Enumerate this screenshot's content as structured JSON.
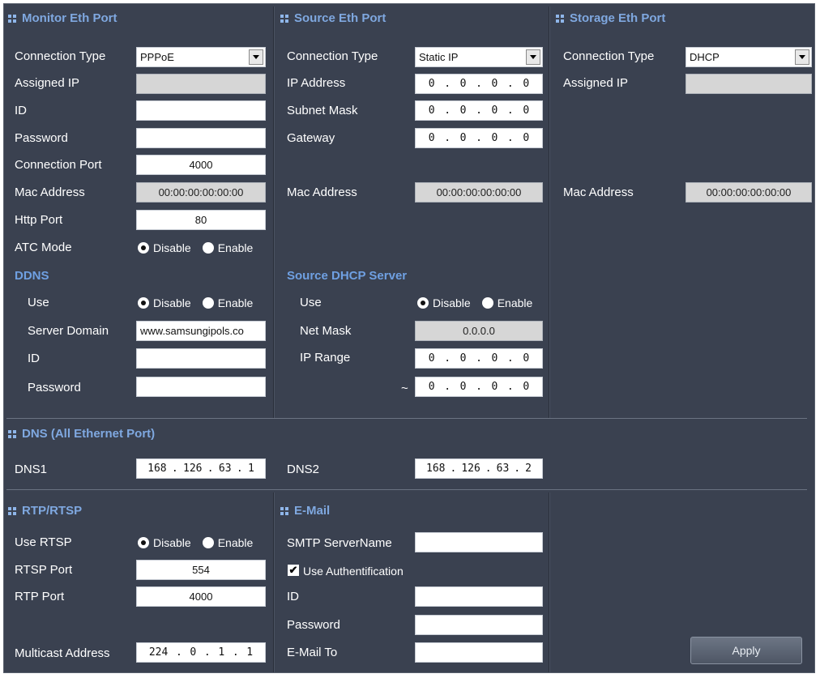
{
  "monitor": {
    "title": "Monitor Eth Port",
    "connection_type_label": "Connection Type",
    "connection_type_value": "PPPoE",
    "assigned_ip_label": "Assigned IP",
    "id_label": "ID",
    "password_label": "Password",
    "connection_port_label": "Connection Port",
    "connection_port_value": "4000",
    "mac_label": "Mac Address",
    "mac_value": "00:00:00:00:00:00",
    "http_port_label": "Http Port",
    "http_port_value": "80",
    "atc_mode_label": "ATC Mode",
    "atc_disable": "Disable",
    "atc_enable": "Enable"
  },
  "ddns": {
    "title": "DDNS",
    "use_label": "Use",
    "use_disable": "Disable",
    "use_enable": "Enable",
    "server_domain_label": "Server Domain",
    "server_domain_value": "www.samsungipols.co",
    "id_label": "ID",
    "password_label": "Password"
  },
  "source": {
    "title": "Source Eth Port",
    "connection_type_label": "Connection Type",
    "connection_type_value": "Static IP",
    "ip_label": "IP Address",
    "subnet_label": "Subnet Mask",
    "gateway_label": "Gateway",
    "ip_value": [
      "0",
      "0",
      "0",
      "0"
    ],
    "subnet_value": [
      "0",
      "0",
      "0",
      "0"
    ],
    "gateway_value": [
      "0",
      "0",
      "0",
      "0"
    ],
    "mac_label": "Mac Address",
    "mac_value": "00:00:00:00:00:00"
  },
  "dhcp": {
    "title": "Source DHCP Server",
    "use_label": "Use",
    "use_disable": "Disable",
    "use_enable": "Enable",
    "netmask_label": "Net Mask",
    "netmask_value": "0.0.0.0",
    "range_label": "IP Range",
    "range_sep": "~",
    "range_start": [
      "0",
      "0",
      "0",
      "0"
    ],
    "range_end": [
      "0",
      "0",
      "0",
      "0"
    ]
  },
  "storage": {
    "title": "Storage Eth Port",
    "connection_type_label": "Connection Type",
    "connection_type_value": "DHCP",
    "assigned_ip_label": "Assigned IP",
    "mac_label": "Mac Address",
    "mac_value": "00:00:00:00:00:00"
  },
  "dns": {
    "title": "DNS (All Ethernet Port)",
    "dns1_label": "DNS1",
    "dns1_value": [
      "168",
      "126",
      "63",
      "1"
    ],
    "dns2_label": "DNS2",
    "dns2_value": [
      "168",
      "126",
      "63",
      "2"
    ]
  },
  "rtp": {
    "title": "RTP/RTSP",
    "use_rtsp_label": "Use RTSP",
    "use_disable": "Disable",
    "use_enable": "Enable",
    "rtsp_port_label": "RTSP Port",
    "rtsp_port_value": "554",
    "rtp_port_label": "RTP Port",
    "rtp_port_value": "4000",
    "multicast_label": "Multicast Address",
    "multicast_value": [
      "224",
      "0",
      "1",
      "1"
    ]
  },
  "email": {
    "title": "E-Mail",
    "smtp_label": "SMTP ServerName",
    "use_auth_label": "Use Authentification",
    "id_label": "ID",
    "password_label": "Password",
    "email_to_label": "E-Mail To"
  },
  "actions": {
    "apply_label": "Apply"
  },
  "colors": {
    "panel_bg": "#3a4150",
    "section_title": "#7fa8e0"
  }
}
